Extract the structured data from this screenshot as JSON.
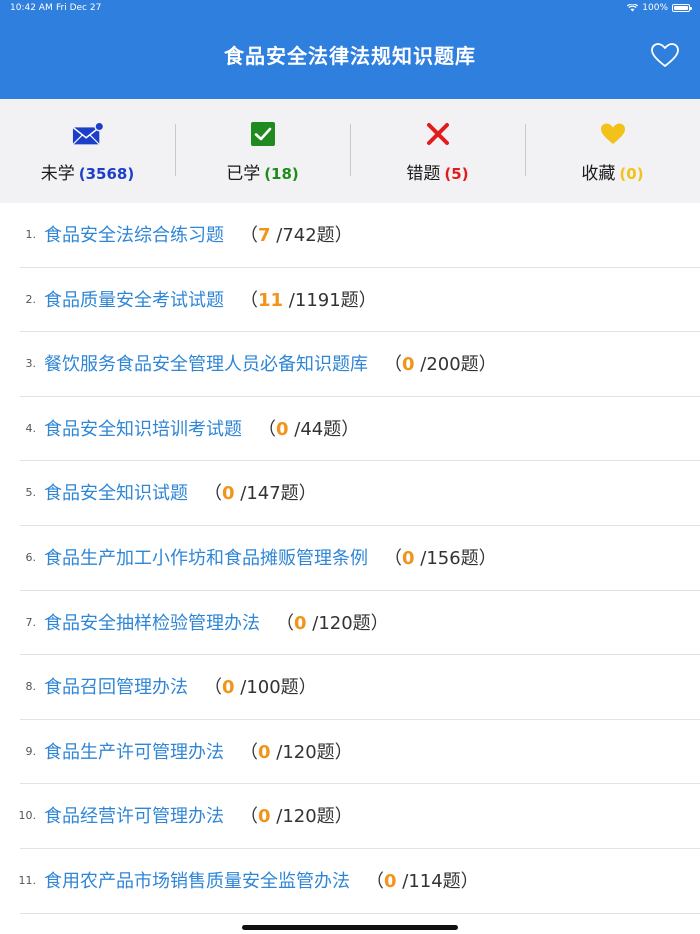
{
  "status_bar": {
    "time": "10:42 AM",
    "date": "Fri Dec 27",
    "battery": "100%"
  },
  "header": {
    "title": "食品安全法律法规知识题库"
  },
  "stats": [
    {
      "label": "未学",
      "count": "(3568)",
      "color": "#1c3fc9",
      "icon": "envelope-icon"
    },
    {
      "label": "已学",
      "count": "(18)",
      "color": "#1f8b1f",
      "icon": "check-icon"
    },
    {
      "label": "错题",
      "count": "(5)",
      "color": "#e21b1b",
      "icon": "cross-icon"
    },
    {
      "label": "收藏",
      "count": "(0)",
      "color": "#f2c21a",
      "icon": "heart-icon"
    }
  ],
  "items": [
    {
      "num": "1.",
      "title": "食品安全法综合练习题",
      "done": "7",
      "total": "/742题）"
    },
    {
      "num": "2.",
      "title": "食品质量安全考试试题",
      "done": "11",
      "total": "/1191题）"
    },
    {
      "num": "3.",
      "title": "餐饮服务食品安全管理人员必备知识题库",
      "done": "0",
      "total": "/200题）"
    },
    {
      "num": "4.",
      "title": "食品安全知识培训考试题",
      "done": "0",
      "total": "/44题）"
    },
    {
      "num": "5.",
      "title": "食品安全知识试题",
      "done": "0",
      "total": "/147题）"
    },
    {
      "num": "6.",
      "title": "食品生产加工小作坊和食品摊贩管理条例",
      "done": "0",
      "total": "/156题）"
    },
    {
      "num": "7.",
      "title": "食品安全抽样检验管理办法",
      "done": "0",
      "total": "/120题）"
    },
    {
      "num": "8.",
      "title": "食品召回管理办法",
      "done": "0",
      "total": "/100题）"
    },
    {
      "num": "9.",
      "title": "食品生产许可管理办法",
      "done": "0",
      "total": "/120题）"
    },
    {
      "num": "10.",
      "title": "食品经营许可管理办法",
      "done": "0",
      "total": "/120题）"
    },
    {
      "num": "11.",
      "title": "食用农产品市场销售质量安全监管办法",
      "done": "0",
      "total": "/114题）"
    }
  ],
  "paren_open": "（"
}
